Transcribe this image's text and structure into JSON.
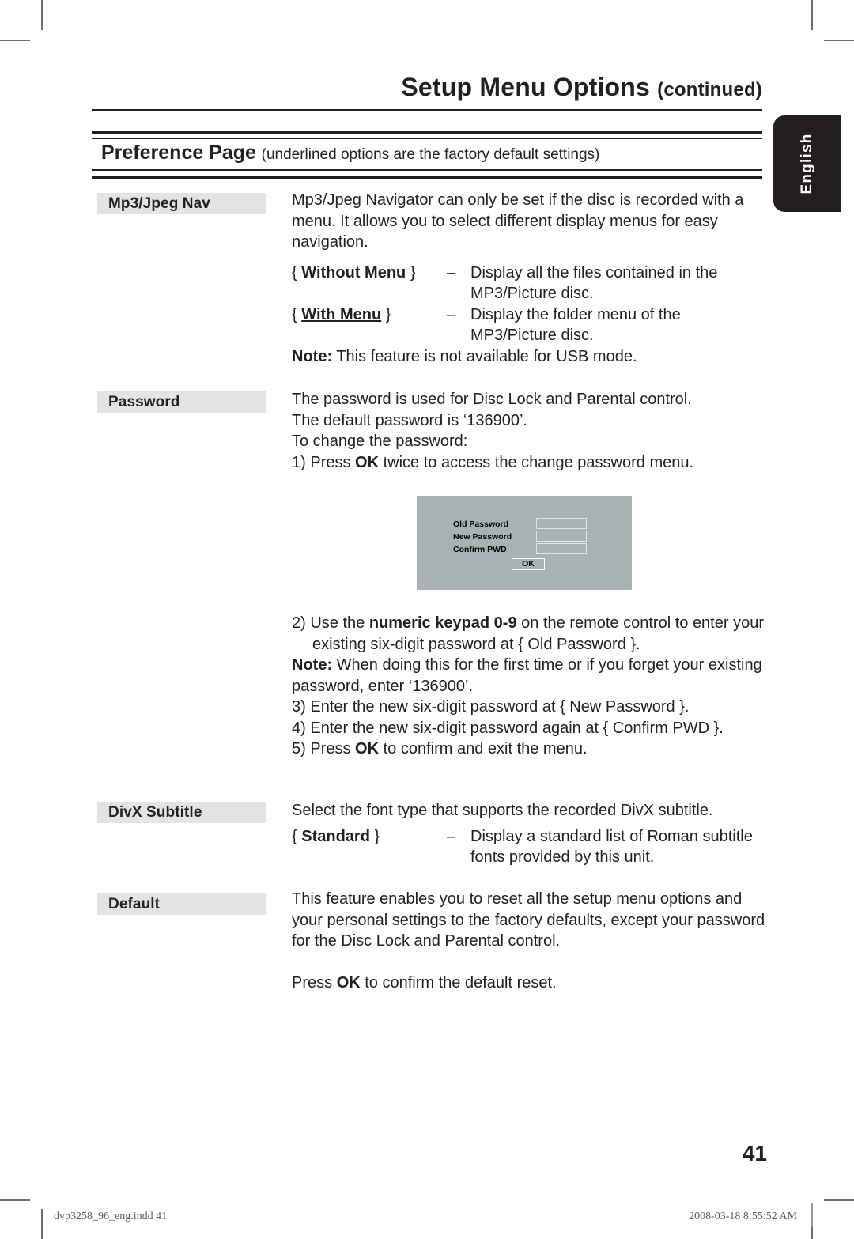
{
  "header": {
    "title": "Setup Menu Options",
    "title_suffix": "(continued)"
  },
  "language_tab": {
    "label": "English"
  },
  "band": {
    "title": "Preference Page",
    "note": "(underlined options are the factory default settings)"
  },
  "sections": [
    {
      "label": "Mp3/Jpeg Nav",
      "intro": "Mp3/Jpeg Navigator can only be set if the disc is recorded with a menu. It allows you to select different display menus for easy navigation.",
      "options": [
        {
          "name_open": "{",
          "name": "Without Menu",
          "name_close": "}",
          "dash": "–",
          "desc": "Display all the files contained in the MP3/Picture disc.",
          "underlined": false
        },
        {
          "name_open": "{",
          "name": "With Menu",
          "name_close": "}",
          "dash": "–",
          "desc": "Display the folder menu of the MP3/Picture disc.",
          "underlined": true
        }
      ],
      "note_label": "Note:",
      "note_text": "This feature is not available for USB mode."
    },
    {
      "label": "Password",
      "lines": [
        "The password is used for Disc Lock and Parental control.",
        "The default password is ‘136900’.",
        "To change the password:"
      ],
      "step1_num": "1)",
      "step1_a": "Press ",
      "step1_b": "OK",
      "step1_c": " twice to access the change password menu.",
      "step2_num": "2)",
      "step2_a": "Use the ",
      "step2_b": "numeric keypad 0-9",
      "step2_c": " on the remote control to enter your existing six-digit password at { Old Password }.",
      "note2_label": "Note:",
      "note2_text": "When doing this for the first time or if you forget your existing password, enter ‘136900’.",
      "step3_num": "3)",
      "step3_text": "Enter the new six-digit password at { New Password }.",
      "step4_num": "4)",
      "step4_text": "Enter the new six-digit password again at { Confirm PWD }.",
      "step5_num": "5)",
      "step5_a": "Press ",
      "step5_b": "OK",
      "step5_c": " to confirm and exit the menu."
    },
    {
      "label": "DivX Subtitle",
      "intro": "Select the font type that supports the recorded DivX subtitle.",
      "options": [
        {
          "name_open": "{",
          "name": "Standard",
          "name_close": "}",
          "dash": "–",
          "desc": "Display a standard list of Roman subtitle fonts provided by this unit.",
          "underlined": false
        }
      ]
    },
    {
      "label": "Default",
      "intro": "This feature enables you to reset all the setup menu options and your personal settings to the factory defaults, except your password for the Disc Lock and Parental control.",
      "press_a": "Press ",
      "press_b": "OK",
      "press_c": " to confirm the default reset."
    }
  ],
  "tv_dialog": {
    "background_color": "#a9b2b2",
    "rows": [
      {
        "label": "Old  Password",
        "value": ""
      },
      {
        "label": "New Password",
        "value": ""
      },
      {
        "label": "Confirm PWD",
        "value": ""
      }
    ],
    "ok_label": "OK"
  },
  "page_number": "41",
  "footer": {
    "left": "dvp3258_96_eng.indd   41",
    "right": "2008-03-18   8:55:52 AM"
  }
}
